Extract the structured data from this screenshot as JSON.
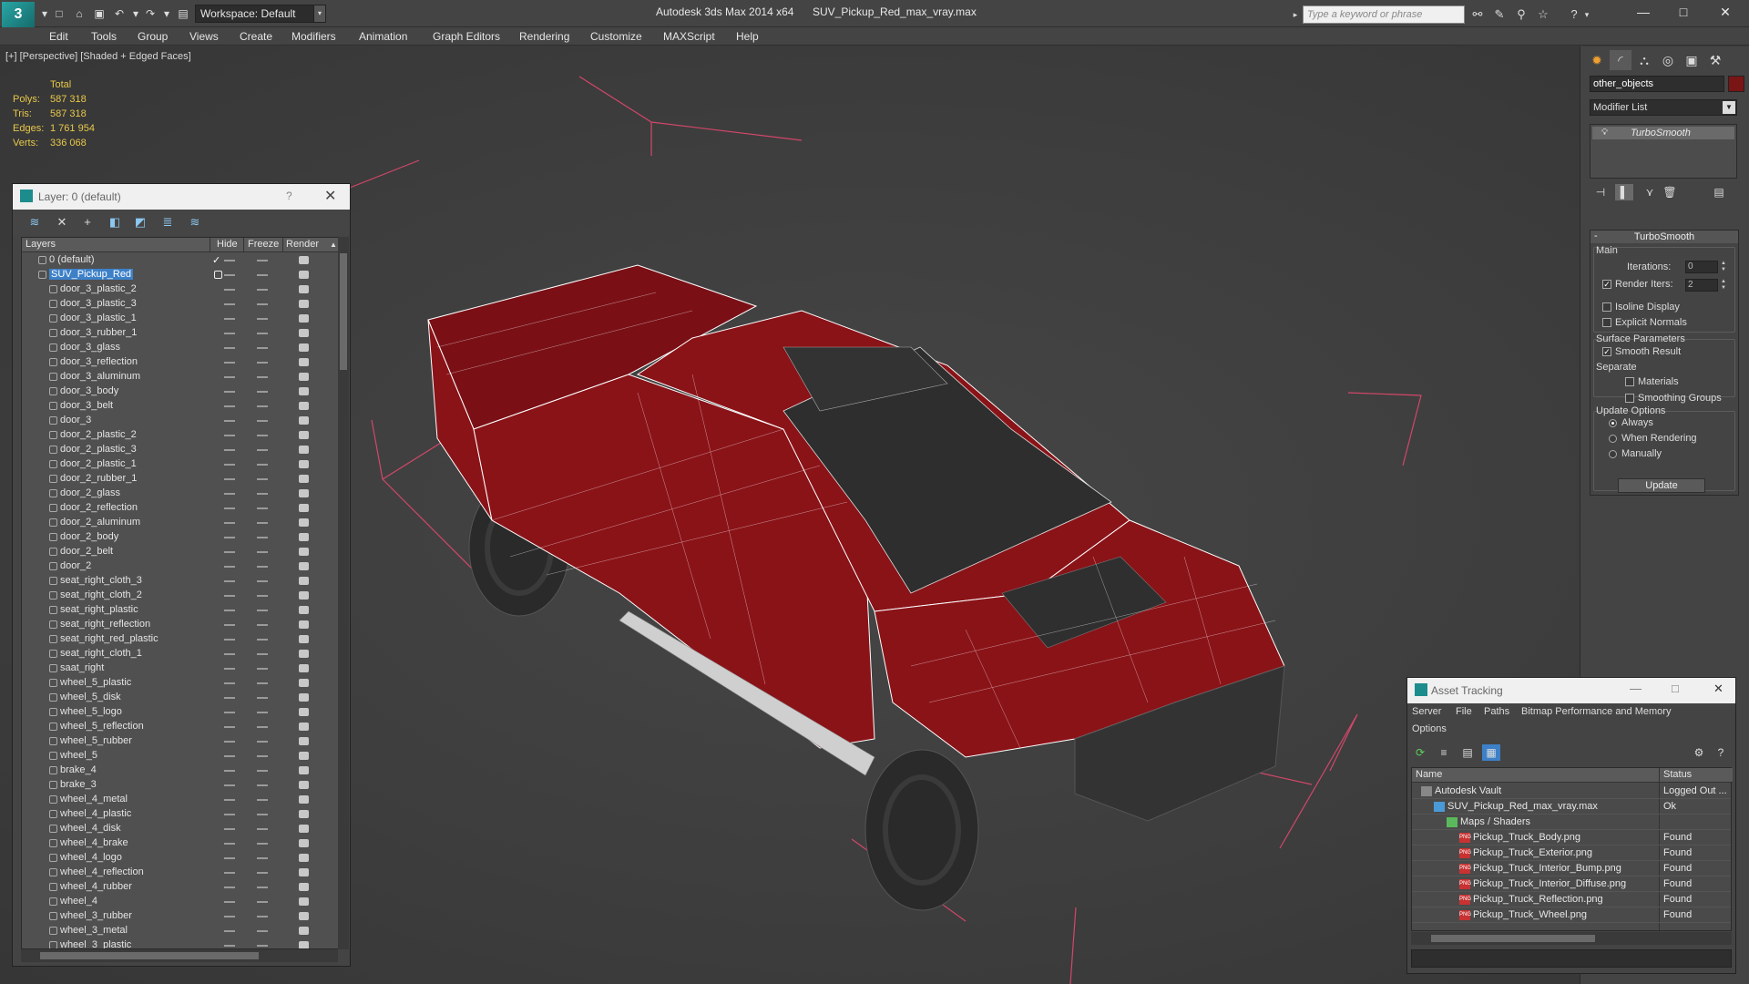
{
  "titlebar": {
    "workspace": "Workspace: Default",
    "app_title": "Autodesk 3ds Max  2014 x64",
    "doc_title": "SUV_Pickup_Red_max_vray.max",
    "search_placeholder": "Type a keyword or phrase"
  },
  "menu": [
    "Edit",
    "Tools",
    "Group",
    "Views",
    "Create",
    "Modifiers",
    "Animation",
    "Graph Editors",
    "Rendering",
    "Customize",
    "MAXScript",
    "Help"
  ],
  "viewport": {
    "label": "[+] [Perspective] [Shaded + Edged Faces]",
    "stats": {
      "header": "Total",
      "rows": [
        {
          "label": "Polys:",
          "value": "587 318"
        },
        {
          "label": "Tris:",
          "value": "587 318"
        },
        {
          "label": "Edges:",
          "value": "1 761 954"
        },
        {
          "label": "Verts:",
          "value": "336 068"
        }
      ]
    },
    "colors": {
      "car_body": "#8a1318",
      "wire": "#ffffff",
      "bbox": "#d2476a"
    }
  },
  "layer_panel": {
    "title": "Layer: 0 (default)",
    "help": "?",
    "columns": [
      "Layers",
      "Hide",
      "Freeze",
      "Render"
    ],
    "layers": [
      {
        "name": "0 (default)",
        "level": 0,
        "checked": true
      },
      {
        "name": "SUV_Pickup_Red",
        "level": 0,
        "selected": true
      },
      {
        "name": "door_3_plastic_2",
        "level": 1
      },
      {
        "name": "door_3_plastic_3",
        "level": 1
      },
      {
        "name": "door_3_plastic_1",
        "level": 1
      },
      {
        "name": "door_3_rubber_1",
        "level": 1
      },
      {
        "name": "door_3_glass",
        "level": 1
      },
      {
        "name": "door_3_reflection",
        "level": 1
      },
      {
        "name": "door_3_aluminum",
        "level": 1
      },
      {
        "name": "door_3_body",
        "level": 1
      },
      {
        "name": "door_3_belt",
        "level": 1
      },
      {
        "name": "door_3",
        "level": 1
      },
      {
        "name": "door_2_plastic_2",
        "level": 1
      },
      {
        "name": "door_2_plastic_3",
        "level": 1
      },
      {
        "name": "door_2_plastic_1",
        "level": 1
      },
      {
        "name": "door_2_rubber_1",
        "level": 1
      },
      {
        "name": "door_2_glass",
        "level": 1
      },
      {
        "name": "door_2_reflection",
        "level": 1
      },
      {
        "name": "door_2_aluminum",
        "level": 1
      },
      {
        "name": "door_2_body",
        "level": 1
      },
      {
        "name": "door_2_belt",
        "level": 1
      },
      {
        "name": "door_2",
        "level": 1
      },
      {
        "name": "seat_right_cloth_3",
        "level": 1
      },
      {
        "name": "seat_right_cloth_2",
        "level": 1
      },
      {
        "name": "seat_right_plastic",
        "level": 1
      },
      {
        "name": "seat_right_reflection",
        "level": 1
      },
      {
        "name": "seat_right_red_plastic",
        "level": 1
      },
      {
        "name": "seat_right_cloth_1",
        "level": 1
      },
      {
        "name": "saat_right",
        "level": 1
      },
      {
        "name": "wheel_5_plastic",
        "level": 1
      },
      {
        "name": "wheel_5_disk",
        "level": 1
      },
      {
        "name": "wheel_5_logo",
        "level": 1
      },
      {
        "name": "wheel_5_reflection",
        "level": 1
      },
      {
        "name": "wheel_5_rubber",
        "level": 1
      },
      {
        "name": "wheel_5",
        "level": 1
      },
      {
        "name": "brake_4",
        "level": 1
      },
      {
        "name": "brake_3",
        "level": 1
      },
      {
        "name": "wheel_4_metal",
        "level": 1
      },
      {
        "name": "wheel_4_plastic",
        "level": 1
      },
      {
        "name": "wheel_4_disk",
        "level": 1
      },
      {
        "name": "wheel_4_brake",
        "level": 1
      },
      {
        "name": "wheel_4_logo",
        "level": 1
      },
      {
        "name": "wheel_4_reflection",
        "level": 1
      },
      {
        "name": "wheel_4_rubber",
        "level": 1
      },
      {
        "name": "wheel_4",
        "level": 1
      },
      {
        "name": "wheel_3_rubber",
        "level": 1
      },
      {
        "name": "wheel_3_metal",
        "level": 1
      },
      {
        "name": "wheel_3_plastic",
        "level": 1
      }
    ]
  },
  "command_panel": {
    "object_name": "other_objects",
    "modifier_list": "Modifier List",
    "stack_item": "TurboSmooth",
    "rollout_title": "TurboSmooth",
    "main_group": "Main",
    "iterations_label": "Iterations:",
    "iterations_value": "0",
    "render_iters_label": "Render Iters:",
    "render_iters_value": "2",
    "isoline_display": "Isoline Display",
    "explicit_normals": "Explicit Normals",
    "surface_params": "Surface Parameters",
    "smooth_result": "Smooth Result",
    "separate": "Separate",
    "materials": "Materials",
    "smoothing_groups": "Smoothing Groups",
    "update_options": "Update Options",
    "always": "Always",
    "when_rendering": "When Rendering",
    "manually": "Manually",
    "update_button": "Update"
  },
  "asset_tracking": {
    "title": "Asset Tracking",
    "menu": [
      "Server",
      "File",
      "Paths",
      "Bitmap Performance and Memory",
      "Options"
    ],
    "columns": [
      "Name",
      "Status"
    ],
    "rows": [
      {
        "name": "Autodesk Vault",
        "status": "Logged Out ...",
        "level": 0,
        "icon": "vault-icon"
      },
      {
        "name": "SUV_Pickup_Red_max_vray.max",
        "status": "Ok",
        "level": 1,
        "icon": "max-file-icon"
      },
      {
        "name": "Maps / Shaders",
        "status": "",
        "level": 2,
        "icon": "maps-icon"
      },
      {
        "name": "Pickup_Truck_Body.png",
        "status": "Found",
        "level": 3,
        "icon": "png-icon"
      },
      {
        "name": "Pickup_Truck_Exterior.png",
        "status": "Found",
        "level": 3,
        "icon": "png-icon"
      },
      {
        "name": "Pickup_Truck_Interior_Bump.png",
        "status": "Found",
        "level": 3,
        "icon": "png-icon"
      },
      {
        "name": "Pickup_Truck_Interior_Diffuse.png",
        "status": "Found",
        "level": 3,
        "icon": "png-icon"
      },
      {
        "name": "Pickup_Truck_Reflection.png",
        "status": "Found",
        "level": 3,
        "icon": "png-icon"
      },
      {
        "name": "Pickup_Truck_Wheel.png",
        "status": "Found",
        "level": 3,
        "icon": "png-icon"
      }
    ],
    "png_badge": "PNG"
  }
}
